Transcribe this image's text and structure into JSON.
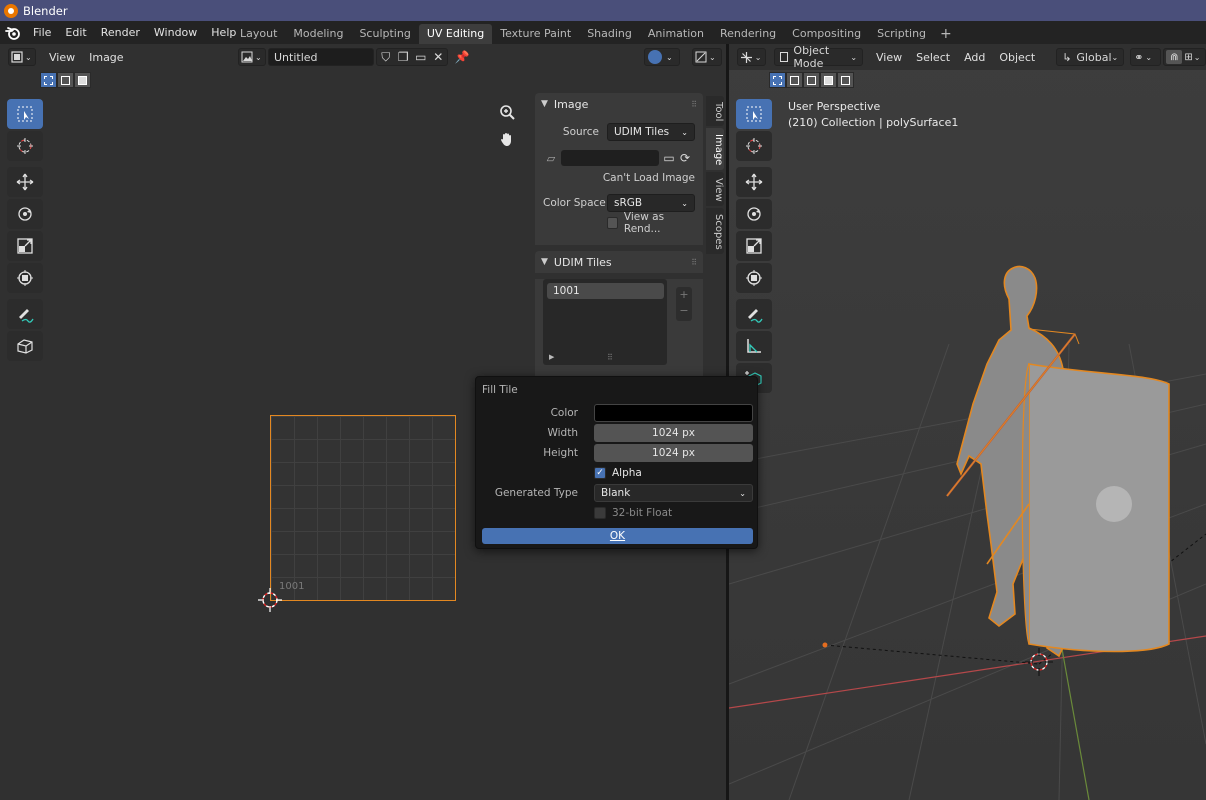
{
  "title_bar": {
    "app_name": "Blender"
  },
  "menu": {
    "items": [
      "File",
      "Edit",
      "Render",
      "Window",
      "Help"
    ]
  },
  "workspaces": {
    "tabs": [
      "Layout",
      "Modeling",
      "Sculpting",
      "UV Editing",
      "Texture Paint",
      "Shading",
      "Animation",
      "Rendering",
      "Compositing",
      "Scripting"
    ],
    "active": "UV Editing",
    "add_symbol": "+"
  },
  "uv_editor": {
    "header": {
      "view_label": "View",
      "image_label": "Image",
      "image_name": "Untitled"
    },
    "tile_label": "1001",
    "side_tabs": [
      "Tool",
      "Image",
      "View",
      "Scopes"
    ],
    "active_side_tab": "Image",
    "image_panel": {
      "title": "Image",
      "source_label": "Source",
      "source_value": "UDIM Tiles",
      "cant_load": "Can't Load Image",
      "color_space_label": "Color Space",
      "color_space_value": "sRGB",
      "view_as_render": "View as Rend..."
    },
    "udim_panel": {
      "title": "UDIM Tiles",
      "tile": "1001",
      "plus": "+",
      "minus": "−"
    }
  },
  "fill_tile": {
    "title": "Fill Tile",
    "color_label": "Color",
    "color_value": "#000000",
    "width_label": "Width",
    "width_value": "1024 px",
    "height_label": "Height",
    "height_value": "1024 px",
    "alpha_label": "Alpha",
    "alpha_checked": true,
    "generated_type_label": "Generated Type",
    "generated_type_value": "Blank",
    "float_label": "32-bit Float",
    "float_checked": false,
    "ok_label": "OK"
  },
  "viewport": {
    "mode": "Object Mode",
    "menus": [
      "View",
      "Select",
      "Add",
      "Object"
    ],
    "orientation": "Global",
    "perspective_text": "User Perspective",
    "collection_text": "(210) Collection | polySurface1"
  },
  "colors": {
    "accent": "#4772b3",
    "selection_outline": "#e38821"
  }
}
